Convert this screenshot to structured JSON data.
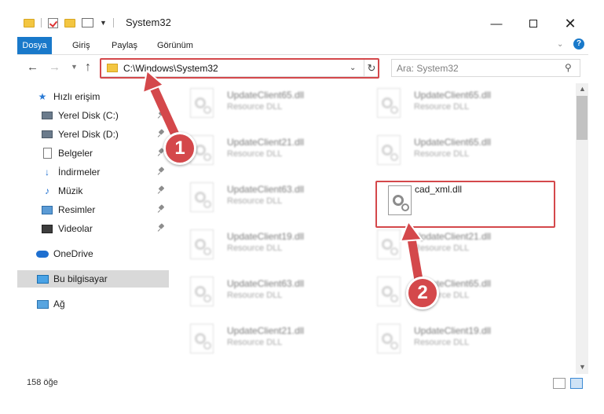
{
  "window": {
    "title": "System32"
  },
  "ribbon": {
    "tabs": [
      {
        "label": "Dosya"
      },
      {
        "label": "Giriş"
      },
      {
        "label": "Paylaş"
      },
      {
        "label": "Görünüm"
      }
    ],
    "help": "?"
  },
  "address_bar": {
    "path": "C:\\Windows\\System32"
  },
  "search": {
    "placeholder": "Ara: System32"
  },
  "sidebar": {
    "items": [
      {
        "label": "Hızlı erişim",
        "icon": "star-icon"
      },
      {
        "label": "Yerel Disk (C:)",
        "icon": "drive-icon",
        "pinned": true
      },
      {
        "label": "Yerel Disk (D:)",
        "icon": "drive-icon",
        "pinned": true
      },
      {
        "label": "Belgeler",
        "icon": "documents-icon",
        "pinned": true
      },
      {
        "label": "İndirmeler",
        "icon": "downloads-icon",
        "pinned": true
      },
      {
        "label": "Müzik",
        "icon": "music-icon",
        "pinned": true
      },
      {
        "label": "Resimler",
        "icon": "pictures-icon",
        "pinned": true
      },
      {
        "label": "Videolar",
        "icon": "videos-icon",
        "pinned": true
      },
      {
        "label": "OneDrive",
        "icon": "onedrive-icon"
      },
      {
        "label": "Bu bilgisayar",
        "icon": "this-pc-icon",
        "selected": true
      },
      {
        "label": "Ağ",
        "icon": "network-icon"
      }
    ]
  },
  "files": [
    {
      "name": "UpdateClient65.dll",
      "type": "Resource DLL"
    },
    {
      "name": "UpdateClient65.dll",
      "type": "Resource DLL"
    },
    {
      "name": "UpdateClient21.dll",
      "type": "Resource DLL"
    },
    {
      "name": "UpdateClient65.dll",
      "type": "Resource DLL"
    },
    {
      "name": "UpdateClient63.dll",
      "type": "Resource DLL"
    },
    {
      "name": "cad_xml.dll",
      "type": ""
    },
    {
      "name": "UpdateClient19.dll",
      "type": "Resource DLL"
    },
    {
      "name": "UpdateClient21.dll",
      "type": "Resource DLL"
    },
    {
      "name": "UpdateClient63.dll",
      "type": "Resource DLL"
    },
    {
      "name": "UpdateClient65.dll",
      "type": "Resource DLL"
    },
    {
      "name": "UpdateClient21.dll",
      "type": "Resource DLL"
    },
    {
      "name": "UpdateClient19.dll",
      "type": "Resource DLL"
    }
  ],
  "status": {
    "item_count": "158 öğe"
  },
  "annotations": [
    {
      "number": "1"
    },
    {
      "number": "2"
    }
  ],
  "colors": {
    "accent": "#1979ca",
    "annotation": "#d4484b",
    "folder": "#f3c641"
  }
}
